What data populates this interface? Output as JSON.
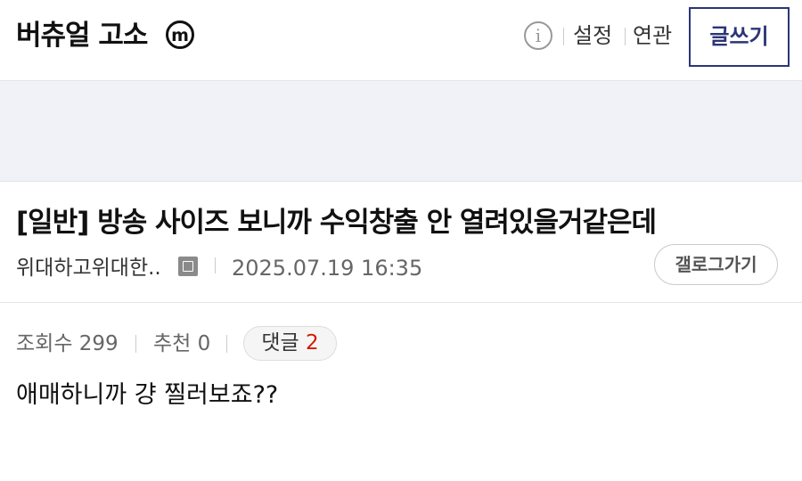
{
  "header": {
    "gallery_title": "버츄얼 고소",
    "minor_badge": "m",
    "info_icon": "info-icon",
    "settings_label": "설정",
    "related_label": "연관",
    "write_label": "글쓰기"
  },
  "post": {
    "category": "[일반]",
    "title": "[일반] 방송 사이즈 보니까 수익창출 안 열려있을거같은데",
    "author": "위대하고위대한..",
    "author_icon": "fixed-nick-icon",
    "date": "2025.07.19 16:35",
    "gallog_label": "갤로그가기",
    "views_label": "조회수 299",
    "recommend_label": "추천 0",
    "comment_label": "댓글",
    "comment_count": "2",
    "body": "애매하니까 걍 찔러보죠??"
  },
  "colors": {
    "accent": "#2b3577",
    "comment_count": "#d31900",
    "banner_bg": "#f0f2f8"
  }
}
